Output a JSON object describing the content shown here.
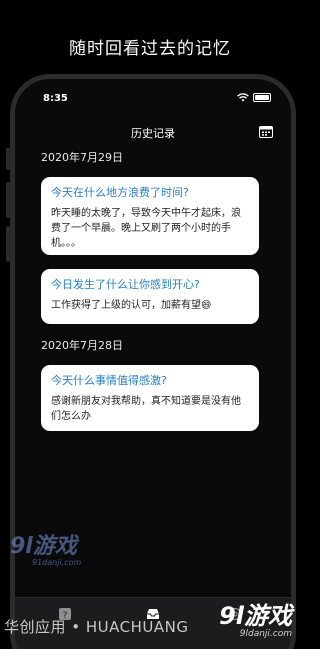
{
  "promo": {
    "title": "随时回看过去的记忆"
  },
  "status": {
    "time": "8:35"
  },
  "nav": {
    "title": "历史记录",
    "calendar_icon": "calendar-icon"
  },
  "entries": [
    {
      "date": "2020年7月29日",
      "cards": [
        {
          "question": "今天在什么地方浪费了时间?",
          "answer": "昨天睡的太晚了，导致今天中午才起床，浪费了一个早晨。晚上又刷了两个小时的手机。。。"
        },
        {
          "question": "今日发生了什么让你感到开心?",
          "answer": "工作获得了上级的认可，加薪有望😄"
        }
      ]
    },
    {
      "date": "2020年7月28日",
      "cards": [
        {
          "question": "今天什么事情值得感激?",
          "answer": "感谢新朋友对我帮助，真不知道要是没有他们怎么办"
        }
      ]
    }
  ],
  "tabs": [
    {
      "name": "help-icon",
      "active": false
    },
    {
      "name": "inbox-icon",
      "active": true
    },
    {
      "name": "settings-icon",
      "active": false
    }
  ],
  "watermarks": {
    "left_logo": "9l游戏",
    "left_url": "91danji.com",
    "bottom_text": "华创应用 • HUACHUANG",
    "right_logo": "9l游戏",
    "right_url": "9ldanji.com"
  },
  "colors": {
    "accent": "#2a7fbd",
    "background": "#000000",
    "card": "#ffffff"
  }
}
